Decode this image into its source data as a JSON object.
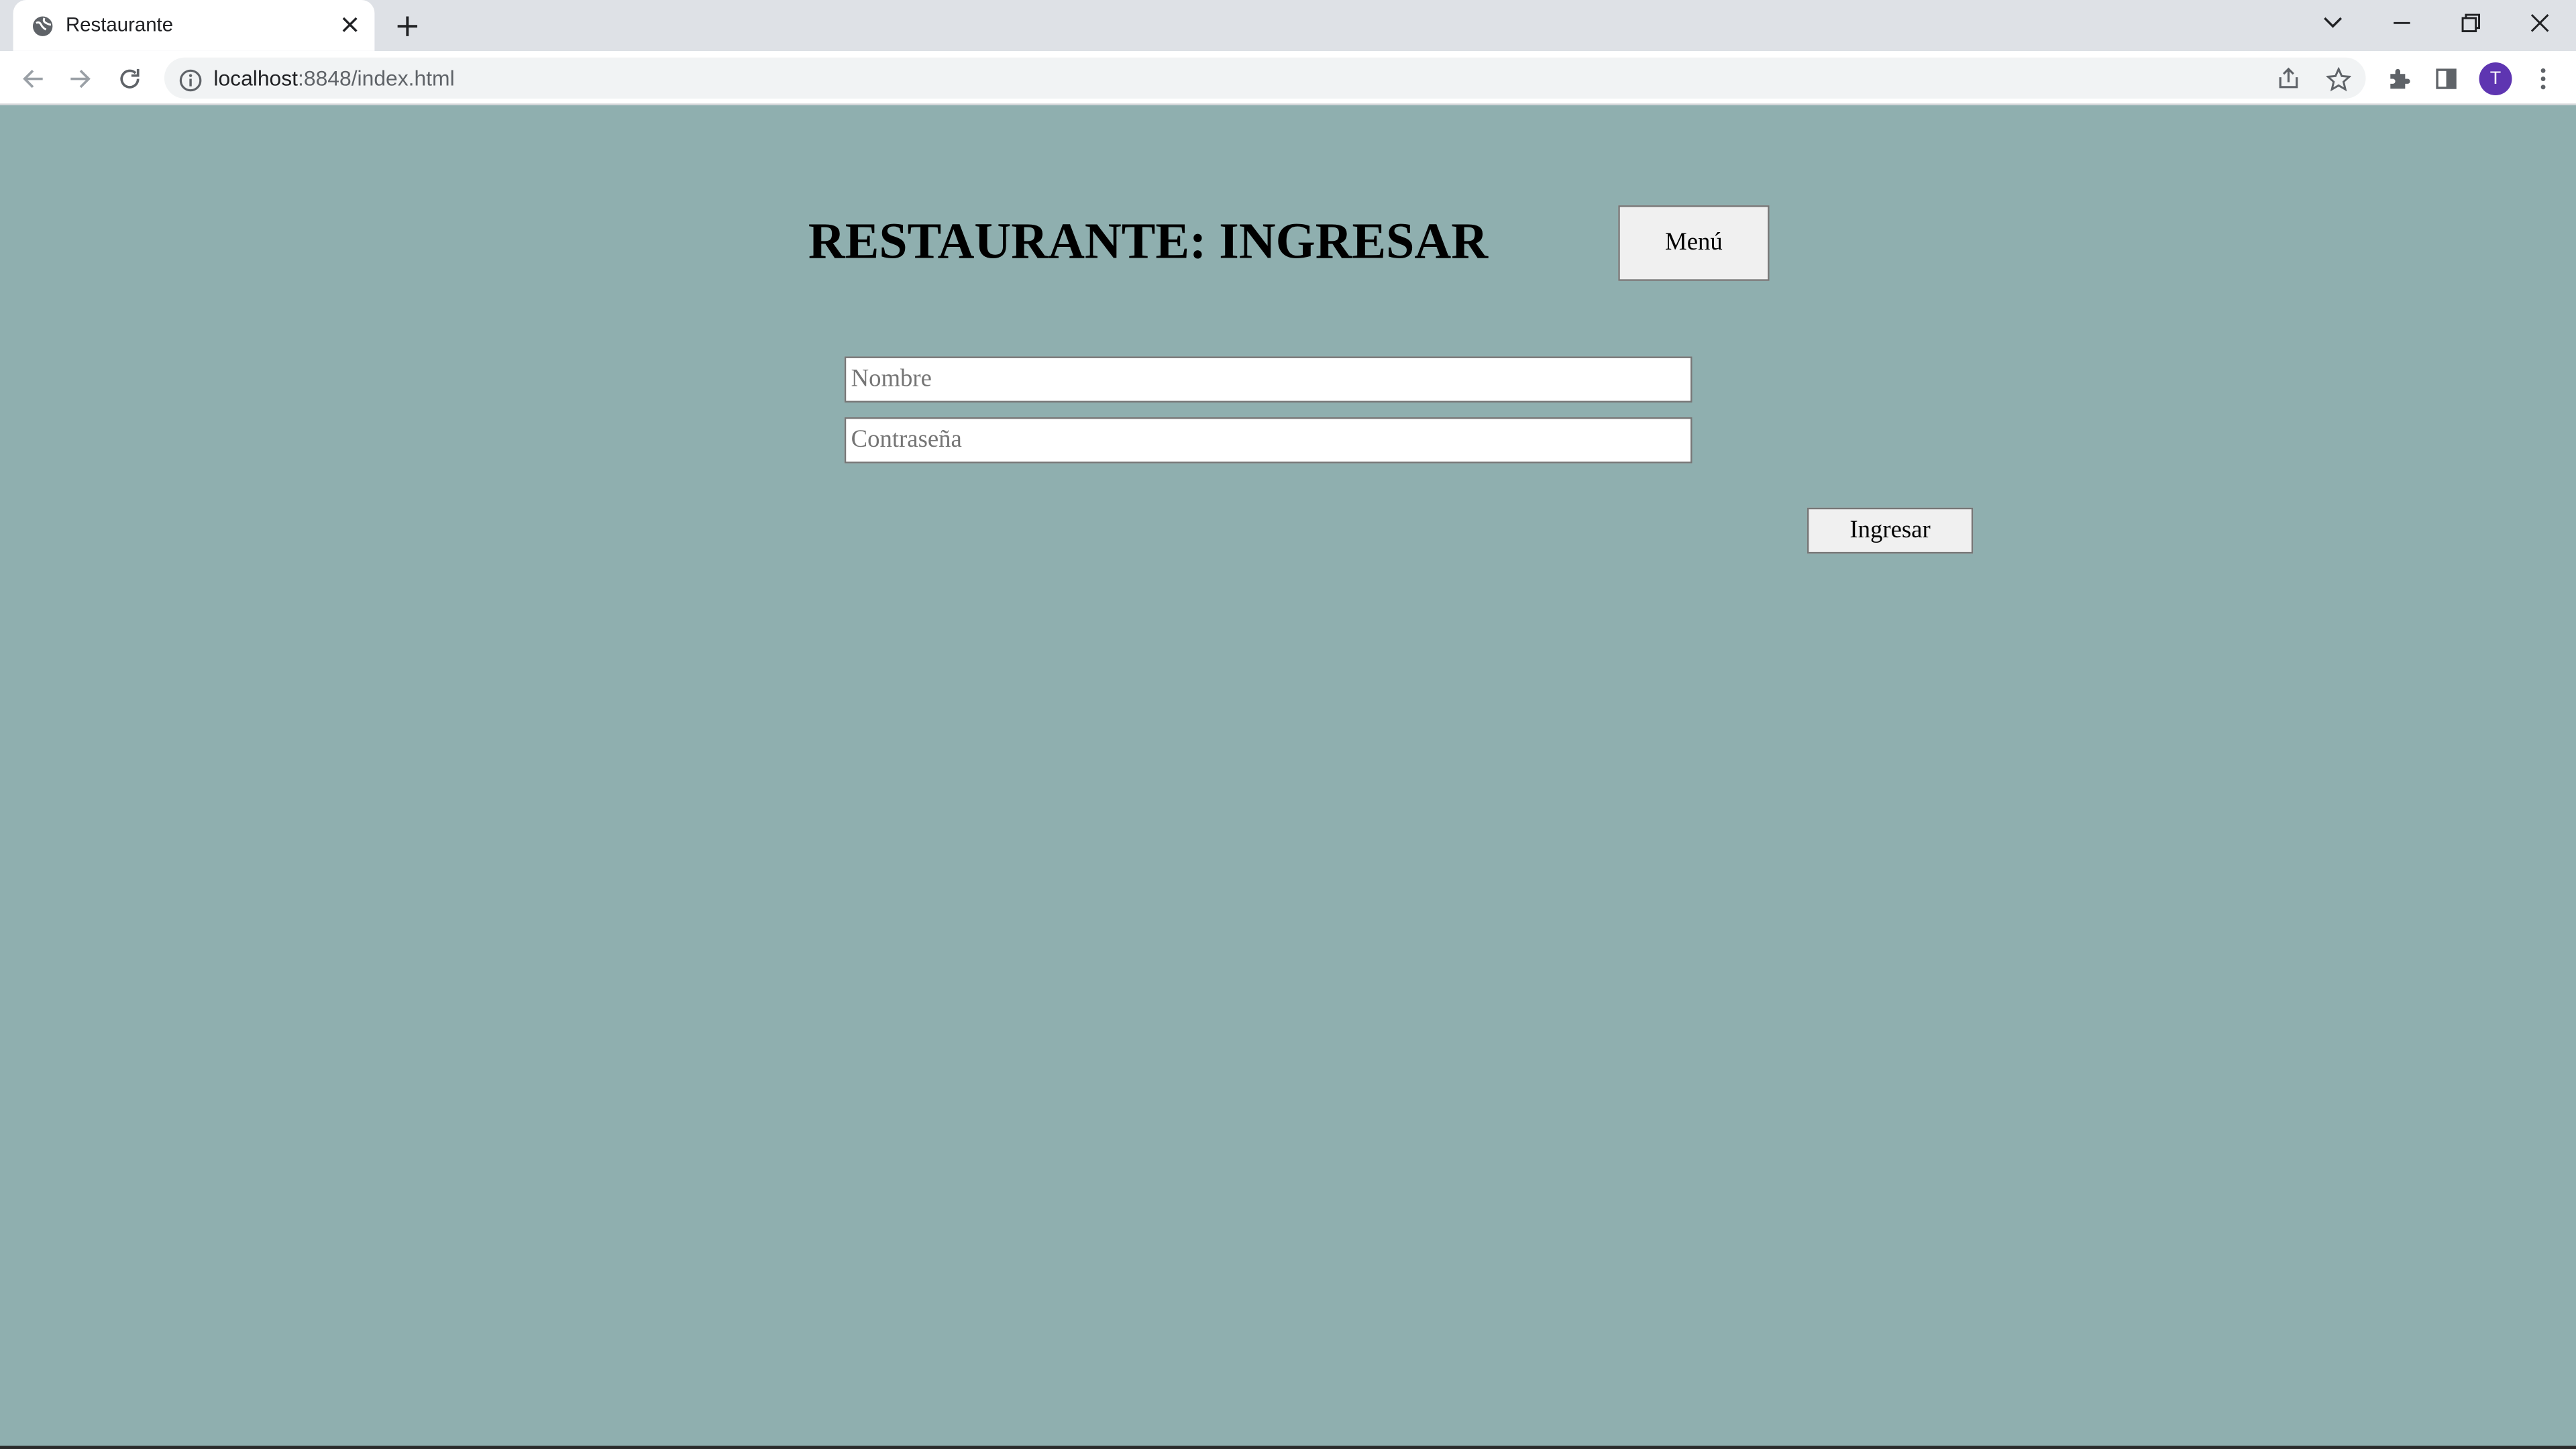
{
  "browser": {
    "tab_title": "Restaurante",
    "url_host": "localhost",
    "url_path": ":8848/index.html",
    "profile_initial": "T"
  },
  "page": {
    "title": "RESTAURANTE: INGRESAR",
    "menu_label": "Menú",
    "name_placeholder": "Nombre",
    "password_placeholder": "Contraseña",
    "submit_label": "Ingresar"
  },
  "colors": {
    "page_background": "#8fafaf",
    "tabbar_background": "#dee1e6",
    "avatar": "#5e35b1"
  }
}
